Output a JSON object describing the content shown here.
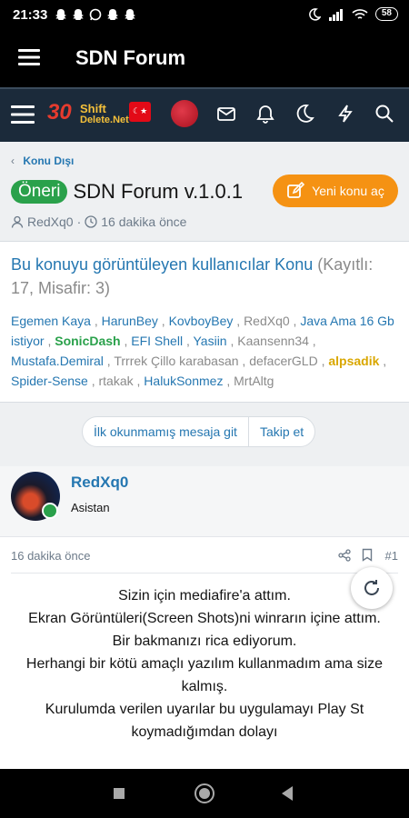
{
  "status_bar": {
    "time": "21:33",
    "battery": "58"
  },
  "app_bar": {
    "title": "SDN Forum"
  },
  "site": {
    "logo_number": "30",
    "logo_line1": "Shift",
    "logo_line2": "Delete.Net"
  },
  "breadcrumb": {
    "label": "Konu Dışı"
  },
  "thread": {
    "prefix": "Öneri",
    "title": "SDN Forum v.1.0.1",
    "author": "RedXq0",
    "time": "16 dakika önce",
    "new_thread_button": "Yeni konu aç"
  },
  "viewers": {
    "heading": "Bu konuyu görüntüleyen kullanıcılar Konu",
    "count": "(Kayıtlı: 17, Misafir: 3)",
    "users": [
      {
        "name": "Egemen Kaya",
        "style": "link"
      },
      {
        "name": "HarunBey",
        "style": "link"
      },
      {
        "name": "KovboyBey",
        "style": "link"
      },
      {
        "name": "RedXq0",
        "style": "gray"
      },
      {
        "name": "Java Ama 16 Gb istiyor",
        "style": "link"
      },
      {
        "name": "SonicDash",
        "style": "green"
      },
      {
        "name": "EFI Shell",
        "style": "link"
      },
      {
        "name": "Yasiin",
        "style": "link"
      },
      {
        "name": "Kaansenn34",
        "style": "gray"
      },
      {
        "name": "Mustafa.Demiral",
        "style": "link"
      },
      {
        "name": "Trrrek Çillo karabasan",
        "style": "gray"
      },
      {
        "name": "defacerGLD",
        "style": "gray"
      },
      {
        "name": "alpsadik",
        "style": "yellow"
      },
      {
        "name": "Spider-Sense",
        "style": "link"
      },
      {
        "name": "rtakak",
        "style": "gray"
      },
      {
        "name": "HalukSonmez",
        "style": "link"
      },
      {
        "name": "MrtAltg",
        "style": "gray"
      }
    ]
  },
  "actions": {
    "first_unread": "İlk okunmamış mesaja git",
    "follow": "Takip et"
  },
  "post": {
    "username": "RedXq0",
    "role": "Asistan",
    "time": "16 dakika önce",
    "number": "#1",
    "body": [
      "Sizin için mediafire'a attım.",
      "Ekran Görüntüleri(Screen Shots)ni winrarın içine attım.",
      "Bir bakmanızı rica ediyorum.",
      "Herhangi bir kötü amaçlı yazılım kullanmadım ama size kalmış.",
      "Kurulumda verilen uyarılar bu uygulamayı Play St",
      "koymadığımdan dolayı"
    ]
  }
}
